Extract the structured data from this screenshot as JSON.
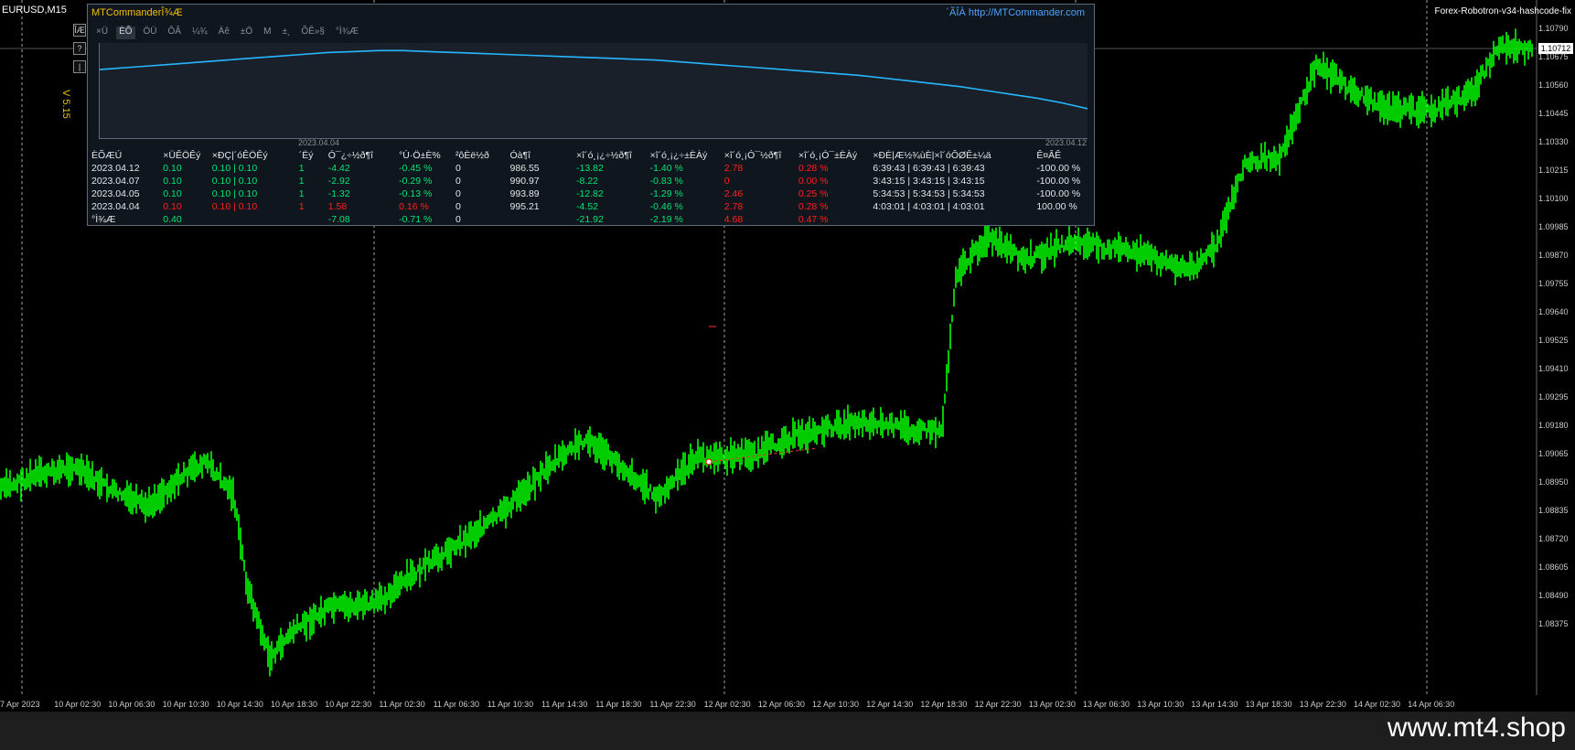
{
  "chart": {
    "symbol": "EURUSD,M15",
    "version": "V 5.15",
    "ea_name": "Forex-Robotron-v34-hashcode-fix",
    "current_price": "1.10712",
    "price_levels": [
      "1.10790",
      "1.10675",
      "1.10560",
      "1.10445",
      "1.10330",
      "1.10215",
      "1.10100",
      "1.09985",
      "1.09870",
      "1.09755",
      "1.09640",
      "1.09525",
      "1.09410",
      "1.09295",
      "1.09180",
      "1.09065",
      "1.08950",
      "1.08835",
      "1.08720",
      "1.08605",
      "1.08490",
      "1.08375"
    ],
    "time_labels": [
      "7 Apr 2023",
      "10 Apr 02:30",
      "10 Apr 06:30",
      "10 Apr 10:30",
      "10 Apr 14:30",
      "10 Apr 18:30",
      "10 Apr 22:30",
      "11 Apr 02:30",
      "11 Apr 06:30",
      "11 Apr 10:30",
      "11 Apr 14:30",
      "11 Apr 18:30",
      "11 Apr 22:30",
      "12 Apr 02:30",
      "12 Apr 06:30",
      "12 Apr 10:30",
      "12 Apr 14:30",
      "12 Apr 18:30",
      "12 Apr 22:30",
      "13 Apr 02:30",
      "13 Apr 06:30",
      "13 Apr 10:30",
      "13 Apr 14:30",
      "13 Apr 18:30",
      "13 Apr 22:30",
      "14 Apr 02:30",
      "14 Apr 06:30"
    ],
    "side_buttons": [
      "ÎÆ",
      "?",
      "|"
    ],
    "colors": {
      "candle": "#00ff00",
      "grid": "#ffffff",
      "background": "#000000"
    }
  },
  "panel": {
    "title": "MTCommanderÎ¾Æ",
    "link": "´ÃÎÀ http://MTCommander.com",
    "tabs": [
      "×Ü",
      "ÈÕ",
      "ÖÜ",
      "ÔÂ",
      "¼¾",
      "Äê",
      "±Ö",
      "M",
      "±¸",
      "ÕÊ»§",
      "°Ì¾Æ"
    ],
    "active_tab": 1,
    "equity_start_label": "2023.04.04",
    "equity_end_label": "2023.04.12",
    "equity_curve": [
      0.72,
      0.74,
      0.76,
      0.78,
      0.8,
      0.82,
      0.84,
      0.86,
      0.88,
      0.9,
      0.91,
      0.92,
      0.92,
      0.91,
      0.9,
      0.89,
      0.88,
      0.87,
      0.86,
      0.85,
      0.84,
      0.83,
      0.82,
      0.8,
      0.78,
      0.76,
      0.74,
      0.72,
      0.7,
      0.68,
      0.66,
      0.63,
      0.6,
      0.57,
      0.54,
      0.5,
      0.46,
      0.42,
      0.37,
      0.31
    ],
    "headers": [
      "ÈÕÆÚ",
      "×ÜÊÖÊý",
      "×ÐÇ|´óÊÖÊý",
      "´Ëý",
      "Ó¯¿÷½ð¶î",
      "°Ù·Ö±È%",
      "²ôÈë½ð",
      "Óà¶î",
      "×î´ó¸¡¿÷½ð¶î",
      "×î´ó¸¡¿÷±ÈÀý",
      "×î´ó¸¡Ó¯½ð¶î",
      "×î´ó¸¡Ó¯±ÈÀý",
      "×ÐÈ|Æ½¾ùÈ|×î´óÔØÊ±¼ä",
      "Ê¤ÂÊ"
    ],
    "rows": [
      {
        "date": "2023.04.12",
        "lots": "0.10",
        "mix": "0.10 | 0.10",
        "count": "1",
        "pnl": "-4.42",
        "pct": "-0.45 %",
        "dep": "0",
        "bal": "986.55",
        "maxdd": "-13.82",
        "maxddp": "-1.40 %",
        "maxfp": "2.78",
        "maxfpp": "0.28 %",
        "hold": "6:39:43 | 6:39:43 | 6:39:43",
        "win": "-100.00 %",
        "tone": "green"
      },
      {
        "date": "2023.04.07",
        "lots": "0.10",
        "mix": "0.10 | 0.10",
        "count": "1",
        "pnl": "-2.92",
        "pct": "-0.29 %",
        "dep": "0",
        "bal": "990.97",
        "maxdd": "-8.22",
        "maxddp": "-0.83 %",
        "maxfp": "0",
        "maxfpp": "0.00 %",
        "hold": "3:43:15 | 3:43:15 | 3:43:15",
        "win": "-100.00 %",
        "tone": "green"
      },
      {
        "date": "2023.04.05",
        "lots": "0.10",
        "mix": "0.10 | 0.10",
        "count": "1",
        "pnl": "-1.32",
        "pct": "-0.13 %",
        "dep": "0",
        "bal": "993.89",
        "maxdd": "-12.82",
        "maxddp": "-1.29 %",
        "maxfp": "2.46",
        "maxfpp": "0.25 %",
        "hold": "5:34:53 | 5:34:53 | 5:34:53",
        "win": "-100.00 %",
        "tone": "green"
      },
      {
        "date": "2023.04.04",
        "lots": "0.10",
        "mix": "0.10 | 0.10",
        "count": "1",
        "pnl": "1.58",
        "pct": "0.16 %",
        "dep": "0",
        "bal": "995.21",
        "maxdd": "-4.52",
        "maxddp": "-0.46 %",
        "maxfp": "2.78",
        "maxfpp": "0.28 %",
        "hold": "4:03:01 | 4:03:01 | 4:03:01",
        "win": "100.00 %",
        "tone": "red"
      }
    ],
    "total": {
      "label": "°Ì¾Æ",
      "lots": "0.40",
      "pnl": "-7.08",
      "pct": "-0.71 %",
      "dep": "0",
      "maxdd": "-21.92",
      "maxddp": "-2.19 %",
      "maxfp": "4.68",
      "maxfpp": "0.47 %"
    }
  },
  "watermark": "www.mt4.shop"
}
